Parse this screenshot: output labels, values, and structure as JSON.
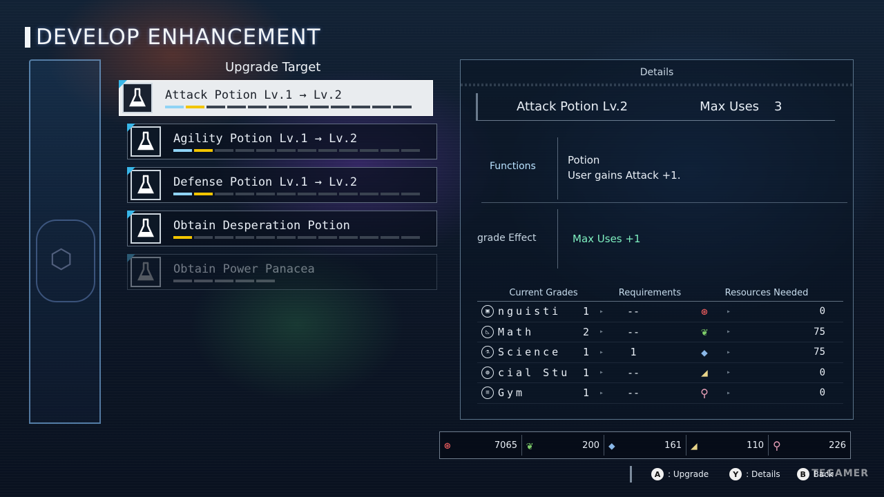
{
  "screen_title": "DEVELOP ENHANCEMENT",
  "list_header": "Upgrade Target",
  "items": [
    {
      "name": "Attack Potion Lv.1 → Lv.2",
      "pips": [
        "blue",
        "yellow",
        "",
        "",
        "",
        "",
        "",
        "",
        "",
        "",
        "",
        ""
      ]
    },
    {
      "name": "Agility Potion Lv.1 → Lv.2",
      "pips": [
        "blue",
        "yellow",
        "",
        "",
        "",
        "",
        "",
        "",
        "",
        "",
        "",
        ""
      ]
    },
    {
      "name": "Defense Potion Lv.1 → Lv.2",
      "pips": [
        "blue",
        "yellow",
        "",
        "",
        "",
        "",
        "",
        "",
        "",
        "",
        "",
        ""
      ]
    },
    {
      "name": "Obtain Desperation Potion",
      "pips": [
        "yellow",
        "",
        "",
        "",
        "",
        "",
        "",
        "",
        "",
        "",
        "",
        ""
      ]
    },
    {
      "name": "Obtain Power Panacea",
      "pips": [
        "",
        "",
        "",
        "",
        ""
      ]
    }
  ],
  "details": {
    "title": "Details",
    "potion_name": "Attack Potion Lv.2",
    "max_uses_label": "Max Uses",
    "max_uses_value": "3",
    "functions_label": "Functions",
    "function_type": "Potion",
    "function_desc": "User gains Attack +1.",
    "effect_label": "grade Effect",
    "effect_value": "Max Uses +1",
    "col_current": "Current Grades",
    "col_req": "Requirements",
    "col_res": "Resources Needed",
    "grades": [
      {
        "icon": "language-icon",
        "name": "nguisti",
        "value": "1",
        "req": "--",
        "res_icon": "gear-resource-icon",
        "res_value": "0"
      },
      {
        "icon": "math-icon",
        "name": "Math",
        "value": "2",
        "req": "--",
        "res_icon": "leaf-resource-icon",
        "res_value": "75"
      },
      {
        "icon": "science-icon",
        "name": "Science",
        "value": "1",
        "req": "1",
        "res_icon": "crystal-resource-icon",
        "res_value": "75"
      },
      {
        "icon": "social-icon",
        "name": "cial Stu",
        "value": "1",
        "req": "--",
        "res_icon": "cheese-resource-icon",
        "res_value": "0"
      },
      {
        "icon": "gym-icon",
        "name": "Gym",
        "value": "1",
        "req": "--",
        "res_icon": "meat-resource-icon",
        "res_value": "0"
      }
    ]
  },
  "resources": [
    {
      "icon": "gear-resource-icon",
      "value": "7065",
      "color": "#e0585a"
    },
    {
      "icon": "leaf-resource-icon",
      "value": "200",
      "color": "#7fcf6a"
    },
    {
      "icon": "crystal-resource-icon",
      "value": "161",
      "color": "#8ab8e8"
    },
    {
      "icon": "cheese-resource-icon",
      "value": "110",
      "color": "#e8d48a"
    },
    {
      "icon": "meat-resource-icon",
      "value": "226",
      "color": "#e8a0b8"
    }
  ],
  "hints": {
    "a_button": "A",
    "a_label": ": Upgrade",
    "y_button": "Y",
    "y_label": ": Details",
    "b_button": "B",
    "b_label": "Back"
  },
  "watermark": "TEGAMER"
}
